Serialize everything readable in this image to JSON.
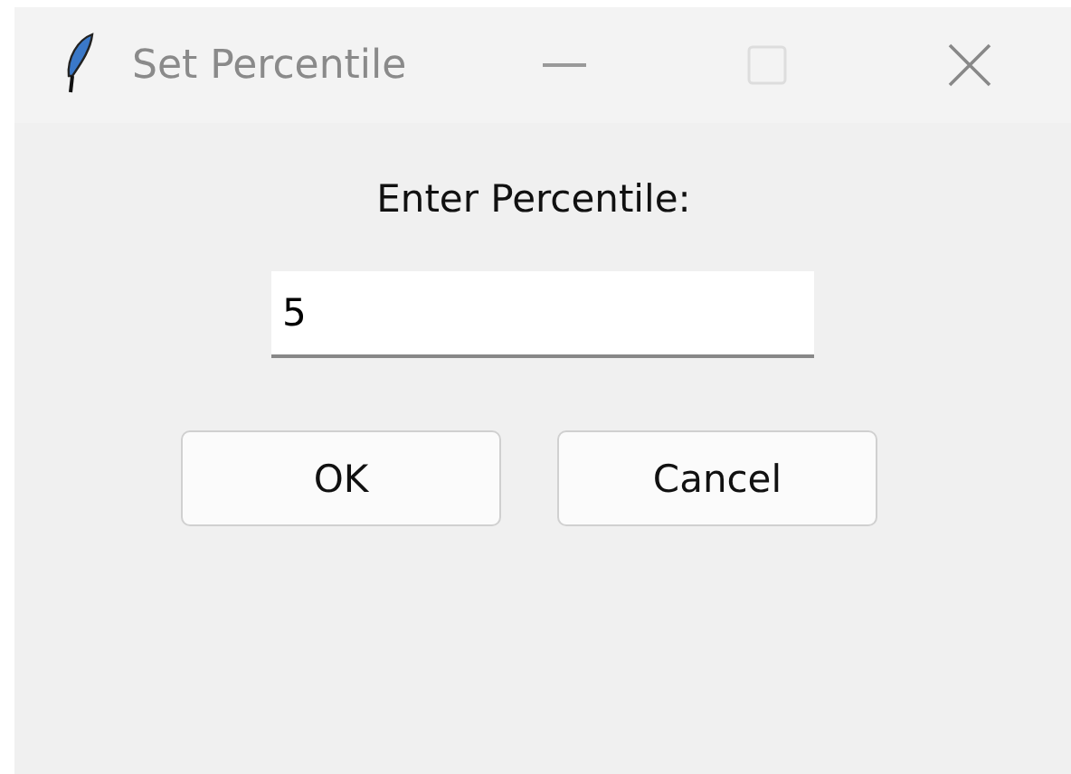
{
  "window": {
    "title": "Set Percentile"
  },
  "prompt": "Enter Percentile:",
  "input": {
    "value": "5"
  },
  "buttons": [
    "OK",
    "Cancel"
  ]
}
